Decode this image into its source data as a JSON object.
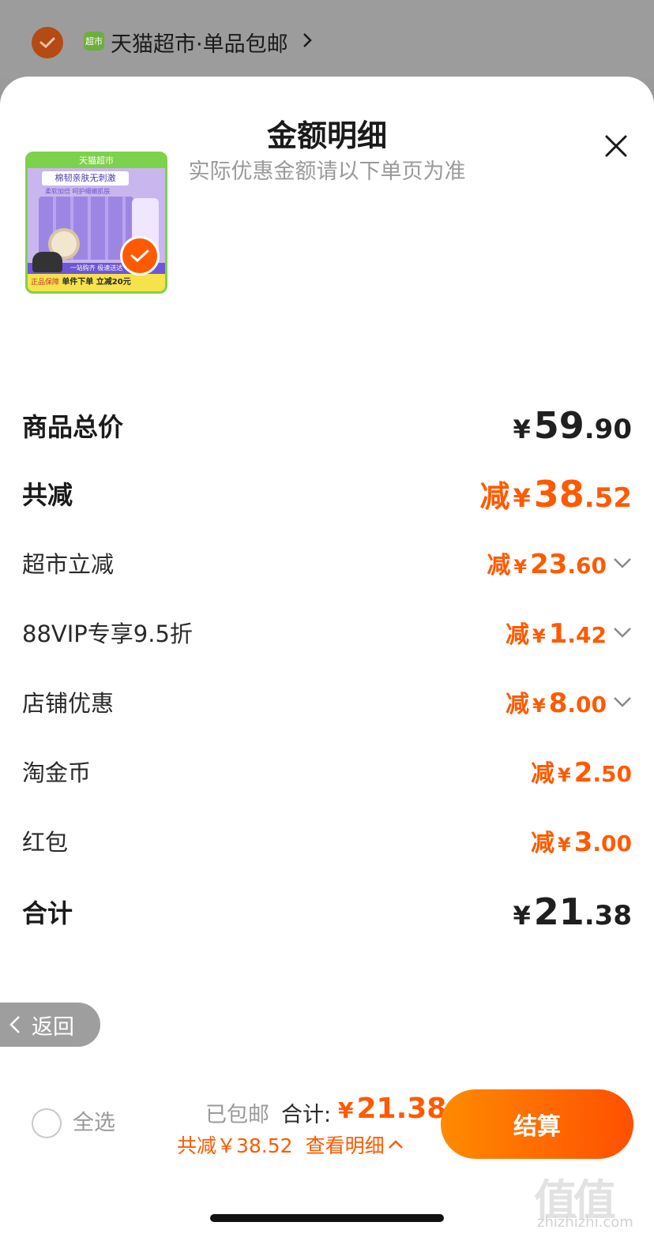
{
  "store": {
    "logo_text": "超市",
    "name": "天猫超市·单品包邮"
  },
  "sheet": {
    "title": "金额明细",
    "subtitle": "实际优惠金额请以下单页为准"
  },
  "product": {
    "banner": "天猫超市",
    "headline": "棉韧亲肤无刺激",
    "sub": "柔软加倍 呵护细嫩肌肤",
    "bar": "一站购齐 极速送达",
    "footer": "单件下单 立减20元",
    "badge": "正品保障"
  },
  "rows": {
    "total_goods": {
      "label": "商品总价",
      "yen": "¥",
      "int": "59",
      "dec": ".90"
    },
    "total_discount": {
      "label": "共减",
      "minus": "减",
      "yen": "¥",
      "int": "38",
      "dec": ".52"
    },
    "discounts": [
      {
        "label": "超市立减",
        "minus": "减",
        "yen": "¥",
        "int": "23",
        "dec": ".60",
        "expandable": true
      },
      {
        "label": "88VIP专享9.5折",
        "minus": "减",
        "yen": "¥",
        "int": "1",
        "dec": ".42",
        "expandable": true
      },
      {
        "label": "店铺优惠",
        "minus": "减",
        "yen": "¥",
        "int": "8",
        "dec": ".00",
        "expandable": true
      },
      {
        "label": "淘金币",
        "minus": "减",
        "yen": "¥",
        "int": "2",
        "dec": ".50",
        "expandable": false
      },
      {
        "label": "红包",
        "minus": "减",
        "yen": "¥",
        "int": "3",
        "dec": ".00",
        "expandable": false
      }
    ],
    "grand_total": {
      "label": "合计",
      "yen": "¥",
      "int": "21",
      "dec": ".38"
    }
  },
  "back": {
    "label": "返回"
  },
  "footer": {
    "select_all": "全选",
    "free_shipping": "已包邮",
    "total_label": "合计:",
    "total_yen": "¥",
    "total_amount": "21.38",
    "discount_summary": "共减￥38.52",
    "view_detail": "查看明细",
    "checkout": "结算"
  },
  "watermark": {
    "text": "值值值",
    "url": "zhizhizhi.com"
  },
  "colors": {
    "accent": "#ff5a00",
    "button_start": "#ff8a00",
    "button_end": "#ff5000",
    "text_muted": "#9a9a9a"
  },
  "icons": [
    "check-icon",
    "chevron-right-icon",
    "close-icon",
    "chevron-down-icon",
    "chevron-left-icon",
    "chevron-up-icon"
  ]
}
